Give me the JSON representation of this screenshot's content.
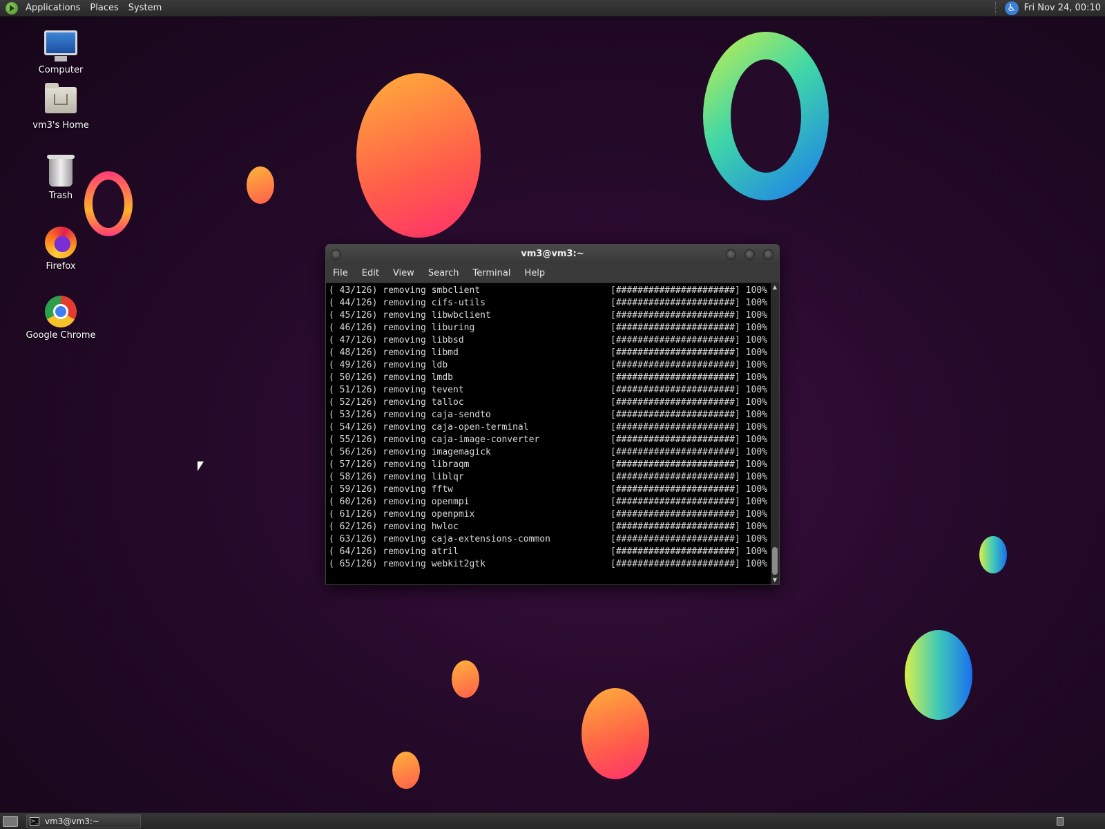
{
  "top_panel": {
    "menus": [
      "Applications",
      "Places",
      "System"
    ],
    "clock": "Fri Nov 24, 00:10"
  },
  "desktop": {
    "icons": [
      {
        "label": "Computer",
        "icon": "computer-icon"
      },
      {
        "label": "vm3's Home",
        "icon": "home-folder-icon"
      },
      {
        "label": "Trash",
        "icon": "trash-icon"
      },
      {
        "label": "Firefox",
        "icon": "firefox-icon"
      },
      {
        "label": "Google Chrome",
        "icon": "chrome-icon"
      }
    ]
  },
  "terminal": {
    "title": "vm3@vm3:~",
    "menus": [
      "File",
      "Edit",
      "View",
      "Search",
      "Terminal",
      "Help"
    ],
    "lines": [
      {
        "left": "( 43/126) removing smbclient",
        "right": "[######################] 100%"
      },
      {
        "left": "( 44/126) removing cifs-utils",
        "right": "[######################] 100%"
      },
      {
        "left": "( 45/126) removing libwbclient",
        "right": "[######################] 100%"
      },
      {
        "left": "( 46/126) removing liburing",
        "right": "[######################] 100%"
      },
      {
        "left": "( 47/126) removing libbsd",
        "right": "[######################] 100%"
      },
      {
        "left": "( 48/126) removing libmd",
        "right": "[######################] 100%"
      },
      {
        "left": "( 49/126) removing ldb",
        "right": "[######################] 100%"
      },
      {
        "left": "( 50/126) removing lmdb",
        "right": "[######################] 100%"
      },
      {
        "left": "( 51/126) removing tevent",
        "right": "[######################] 100%"
      },
      {
        "left": "( 52/126) removing talloc",
        "right": "[######################] 100%"
      },
      {
        "left": "( 53/126) removing caja-sendto",
        "right": "[######################] 100%"
      },
      {
        "left": "( 54/126) removing caja-open-terminal",
        "right": "[######################] 100%"
      },
      {
        "left": "( 55/126) removing caja-image-converter",
        "right": "[######################] 100%"
      },
      {
        "left": "( 56/126) removing imagemagick",
        "right": "[######################] 100%"
      },
      {
        "left": "( 57/126) removing libraqm",
        "right": "[######################] 100%"
      },
      {
        "left": "( 58/126) removing liblqr",
        "right": "[######################] 100%"
      },
      {
        "left": "( 59/126) removing fftw",
        "right": "[######################] 100%"
      },
      {
        "left": "( 60/126) removing openmpi",
        "right": "[######################] 100%"
      },
      {
        "left": "( 61/126) removing openpmix",
        "right": "[######################] 100%"
      },
      {
        "left": "( 62/126) removing hwloc",
        "right": "[######################] 100%"
      },
      {
        "left": "( 63/126) removing caja-extensions-common",
        "right": "[######################] 100%"
      },
      {
        "left": "( 64/126) removing atril",
        "right": "[######################] 100%"
      },
      {
        "left": "( 65/126) removing webkit2gtk",
        "right": "[######################] 100%"
      }
    ]
  },
  "taskbar": {
    "window_button": "vm3@vm3:~"
  },
  "colors": {
    "wallpaper": "#250a2a",
    "panel": "#2f2f2f",
    "terminal_bg": "#000000",
    "terminal_text": "#d9d9d9"
  }
}
